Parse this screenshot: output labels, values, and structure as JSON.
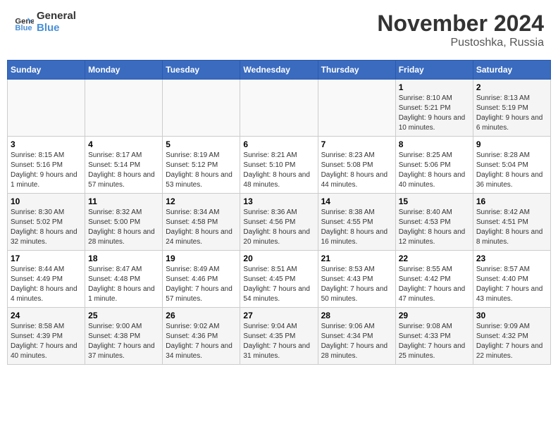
{
  "header": {
    "logo_general": "General",
    "logo_blue": "Blue",
    "month_title": "November 2024",
    "location": "Pustoshka, Russia"
  },
  "calendar": {
    "days_of_week": [
      "Sunday",
      "Monday",
      "Tuesday",
      "Wednesday",
      "Thursday",
      "Friday",
      "Saturday"
    ],
    "weeks": [
      {
        "days": [
          {
            "number": "",
            "info": ""
          },
          {
            "number": "",
            "info": ""
          },
          {
            "number": "",
            "info": ""
          },
          {
            "number": "",
            "info": ""
          },
          {
            "number": "",
            "info": ""
          },
          {
            "number": "1",
            "info": "Sunrise: 8:10 AM\nSunset: 5:21 PM\nDaylight: 9 hours and 10 minutes."
          },
          {
            "number": "2",
            "info": "Sunrise: 8:13 AM\nSunset: 5:19 PM\nDaylight: 9 hours and 6 minutes."
          }
        ]
      },
      {
        "days": [
          {
            "number": "3",
            "info": "Sunrise: 8:15 AM\nSunset: 5:16 PM\nDaylight: 9 hours and 1 minute."
          },
          {
            "number": "4",
            "info": "Sunrise: 8:17 AM\nSunset: 5:14 PM\nDaylight: 8 hours and 57 minutes."
          },
          {
            "number": "5",
            "info": "Sunrise: 8:19 AM\nSunset: 5:12 PM\nDaylight: 8 hours and 53 minutes."
          },
          {
            "number": "6",
            "info": "Sunrise: 8:21 AM\nSunset: 5:10 PM\nDaylight: 8 hours and 48 minutes."
          },
          {
            "number": "7",
            "info": "Sunrise: 8:23 AM\nSunset: 5:08 PM\nDaylight: 8 hours and 44 minutes."
          },
          {
            "number": "8",
            "info": "Sunrise: 8:25 AM\nSunset: 5:06 PM\nDaylight: 8 hours and 40 minutes."
          },
          {
            "number": "9",
            "info": "Sunrise: 8:28 AM\nSunset: 5:04 PM\nDaylight: 8 hours and 36 minutes."
          }
        ]
      },
      {
        "days": [
          {
            "number": "10",
            "info": "Sunrise: 8:30 AM\nSunset: 5:02 PM\nDaylight: 8 hours and 32 minutes."
          },
          {
            "number": "11",
            "info": "Sunrise: 8:32 AM\nSunset: 5:00 PM\nDaylight: 8 hours and 28 minutes."
          },
          {
            "number": "12",
            "info": "Sunrise: 8:34 AM\nSunset: 4:58 PM\nDaylight: 8 hours and 24 minutes."
          },
          {
            "number": "13",
            "info": "Sunrise: 8:36 AM\nSunset: 4:56 PM\nDaylight: 8 hours and 20 minutes."
          },
          {
            "number": "14",
            "info": "Sunrise: 8:38 AM\nSunset: 4:55 PM\nDaylight: 8 hours and 16 minutes."
          },
          {
            "number": "15",
            "info": "Sunrise: 8:40 AM\nSunset: 4:53 PM\nDaylight: 8 hours and 12 minutes."
          },
          {
            "number": "16",
            "info": "Sunrise: 8:42 AM\nSunset: 4:51 PM\nDaylight: 8 hours and 8 minutes."
          }
        ]
      },
      {
        "days": [
          {
            "number": "17",
            "info": "Sunrise: 8:44 AM\nSunset: 4:49 PM\nDaylight: 8 hours and 4 minutes."
          },
          {
            "number": "18",
            "info": "Sunrise: 8:47 AM\nSunset: 4:48 PM\nDaylight: 8 hours and 1 minute."
          },
          {
            "number": "19",
            "info": "Sunrise: 8:49 AM\nSunset: 4:46 PM\nDaylight: 7 hours and 57 minutes."
          },
          {
            "number": "20",
            "info": "Sunrise: 8:51 AM\nSunset: 4:45 PM\nDaylight: 7 hours and 54 minutes."
          },
          {
            "number": "21",
            "info": "Sunrise: 8:53 AM\nSunset: 4:43 PM\nDaylight: 7 hours and 50 minutes."
          },
          {
            "number": "22",
            "info": "Sunrise: 8:55 AM\nSunset: 4:42 PM\nDaylight: 7 hours and 47 minutes."
          },
          {
            "number": "23",
            "info": "Sunrise: 8:57 AM\nSunset: 4:40 PM\nDaylight: 7 hours and 43 minutes."
          }
        ]
      },
      {
        "days": [
          {
            "number": "24",
            "info": "Sunrise: 8:58 AM\nSunset: 4:39 PM\nDaylight: 7 hours and 40 minutes."
          },
          {
            "number": "25",
            "info": "Sunrise: 9:00 AM\nSunset: 4:38 PM\nDaylight: 7 hours and 37 minutes."
          },
          {
            "number": "26",
            "info": "Sunrise: 9:02 AM\nSunset: 4:36 PM\nDaylight: 7 hours and 34 minutes."
          },
          {
            "number": "27",
            "info": "Sunrise: 9:04 AM\nSunset: 4:35 PM\nDaylight: 7 hours and 31 minutes."
          },
          {
            "number": "28",
            "info": "Sunrise: 9:06 AM\nSunset: 4:34 PM\nDaylight: 7 hours and 28 minutes."
          },
          {
            "number": "29",
            "info": "Sunrise: 9:08 AM\nSunset: 4:33 PM\nDaylight: 7 hours and 25 minutes."
          },
          {
            "number": "30",
            "info": "Sunrise: 9:09 AM\nSunset: 4:32 PM\nDaylight: 7 hours and 22 minutes."
          }
        ]
      }
    ]
  }
}
